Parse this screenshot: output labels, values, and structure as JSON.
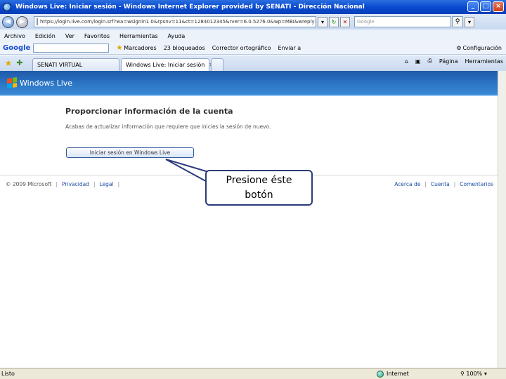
{
  "window": {
    "title": "Windows Live: Iniciar sesión - Windows Internet Explorer provided by SENATI - Dirección Nacional",
    "buttons": {
      "minimize": "_",
      "maximize": "□",
      "close": "×"
    }
  },
  "address_bar": {
    "url": "https://login.live.com/login.srf?wa=wsignin1.0&rpsnv=11&ct=1284012345&rver=6.0.5276.0&wp=MBI&wreply=http://cuenta.live.com/",
    "search_placeholder": "Google"
  },
  "menu": {
    "items": [
      "Archivo",
      "Edición",
      "Ver",
      "Favoritos",
      "Herramientas",
      "Ayuda"
    ]
  },
  "google_toolbar": {
    "logo": "Google",
    "items": [
      "Marcadores",
      "23 bloqueados",
      "Corrector ortográfico",
      "Enviar a",
      "Configuración"
    ]
  },
  "tabs": {
    "items": [
      {
        "label": "SENATI VIRTUAL"
      },
      {
        "label": "Windows Live: Iniciar sesión"
      }
    ],
    "right_tools": [
      "Página",
      "Herramientas"
    ]
  },
  "page": {
    "brand": "Windows Live",
    "heading": "Proporcionar información de la cuenta",
    "subtext": "Acabas de actualizar información que requiere que inicies la sesión de nuevo.",
    "signin_button": "Iniciar sesión en Windows Live",
    "footer_left": [
      "© 2009 Microsoft",
      "Privacidad",
      "Legal"
    ],
    "footer_right": [
      "Acerca de",
      "Cuenta",
      "Comentarios"
    ]
  },
  "callout": {
    "line1": "Presione éste",
    "line2": "botón"
  },
  "status_bar": {
    "status": "Listo",
    "zone": "Internet",
    "zoom": "100%"
  }
}
